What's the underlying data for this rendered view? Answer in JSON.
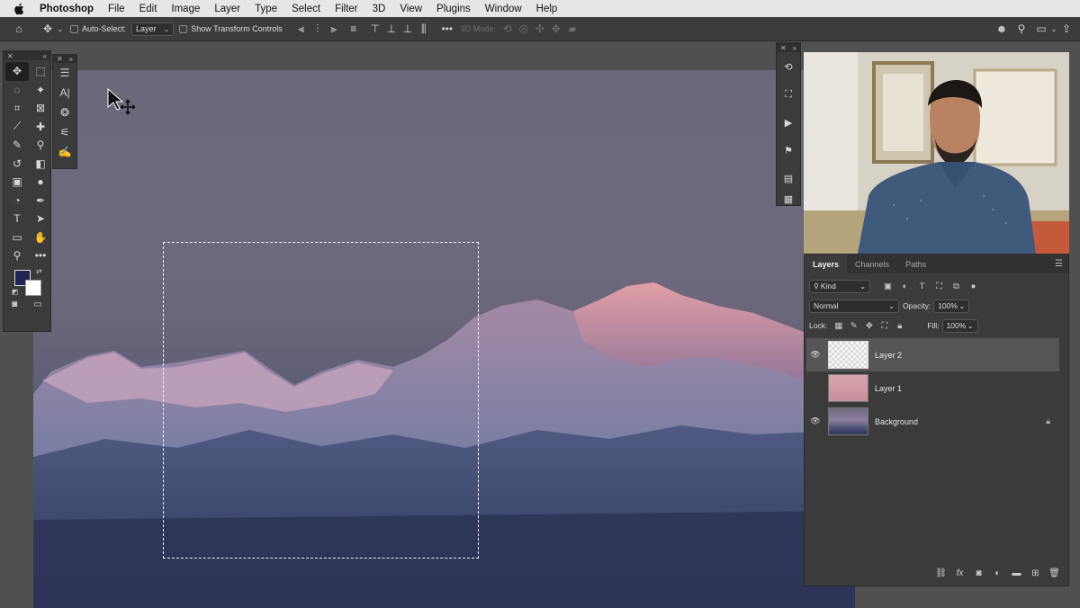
{
  "menubar": {
    "app_name": "Photoshop",
    "items": [
      "File",
      "Edit",
      "Image",
      "Layer",
      "Type",
      "Select",
      "Filter",
      "3D",
      "View",
      "Plugins",
      "Window",
      "Help"
    ]
  },
  "options_bar": {
    "auto_select_label": "Auto-Select:",
    "auto_select_value": "Layer",
    "show_transform_label": "Show Transform Controls",
    "mode_3d_label": "3D Mode:"
  },
  "layers_panel": {
    "tabs": [
      "Layers",
      "Channels",
      "Paths"
    ],
    "filter_kind": "Kind",
    "blend_mode": "Normal",
    "opacity_label": "Opacity:",
    "opacity_value": "100%",
    "lock_label": "Lock:",
    "fill_label": "Fill:",
    "fill_value": "100%",
    "layers": [
      {
        "name": "Layer 2",
        "visible": true,
        "selected": true
      },
      {
        "name": "Layer 1",
        "visible": false,
        "selected": false
      },
      {
        "name": "Background",
        "visible": true,
        "selected": false,
        "locked": true
      }
    ]
  },
  "colors": {
    "foreground": "#1e2552",
    "background": "#ffffff",
    "workspace": "#535353",
    "panel": "#3b3b3b"
  }
}
